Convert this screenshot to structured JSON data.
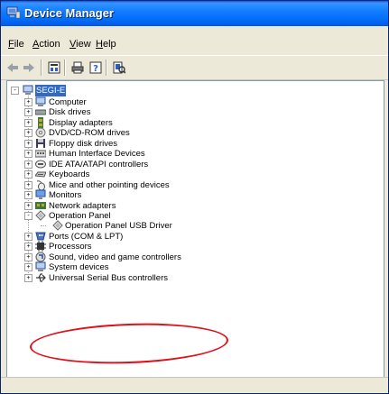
{
  "window": {
    "title": "Device Manager",
    "app_icon": "device-manager-icon",
    "accent": "#0058ee"
  },
  "menu": [
    "File",
    "Action",
    "View",
    "Help"
  ],
  "menu_underline": [
    "F",
    "A",
    "V",
    "H"
  ],
  "toolbar": {
    "buttons": [
      "back-arrow-icon",
      "forward-arrow-icon",
      "properties-icon",
      "print-icon",
      "help-icon",
      "scan-icon"
    ]
  },
  "tree": {
    "root": "SEGI-E",
    "items": [
      {
        "label": "Computer",
        "icon": "computer-icon",
        "expand": "+"
      },
      {
        "label": "Disk drives",
        "icon": "disk-drive-icon",
        "expand": "+"
      },
      {
        "label": "Display adapters",
        "icon": "display-adapter-icon",
        "expand": "+"
      },
      {
        "label": "DVD/CD-ROM drives",
        "icon": "cd-rom-icon",
        "expand": "+"
      },
      {
        "label": "Floppy disk drives",
        "icon": "floppy-icon",
        "expand": "+"
      },
      {
        "label": "Human Interface Devices",
        "icon": "hid-icon",
        "expand": "+"
      },
      {
        "label": "IDE ATA/ATAPI controllers",
        "icon": "ide-controller-icon",
        "expand": "+"
      },
      {
        "label": "Keyboards",
        "icon": "keyboard-icon",
        "expand": "+"
      },
      {
        "label": "Mice and other pointing devices",
        "icon": "mouse-icon",
        "expand": "+"
      },
      {
        "label": "Monitors",
        "icon": "monitor-icon",
        "expand": "+"
      },
      {
        "label": "Network adapters",
        "icon": "network-adapter-icon",
        "expand": "+"
      },
      {
        "label": "Operation Panel",
        "icon": "operation-panel-icon",
        "expand": "-"
      },
      {
        "label": "Operation Panel USB Driver",
        "icon": "usb-driver-icon",
        "expand": "",
        "child": true
      },
      {
        "label": "Ports (COM & LPT)",
        "icon": "port-icon",
        "expand": "+"
      },
      {
        "label": "Processors",
        "icon": "processor-icon",
        "expand": "+"
      },
      {
        "label": "Sound, video and game controllers",
        "icon": "sound-icon",
        "expand": "+"
      },
      {
        "label": "System devices",
        "icon": "system-device-icon",
        "expand": "+"
      },
      {
        "label": "Universal Serial Bus controllers",
        "icon": "usb-controller-icon",
        "expand": "+"
      }
    ]
  },
  "highlight_color": "#e0101a"
}
